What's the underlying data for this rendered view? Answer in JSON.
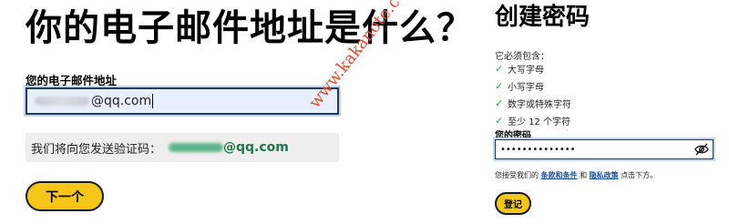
{
  "email_step": {
    "title": "你的电子邮件地址是什么？",
    "field_label": "您的电子邮件地址",
    "email_suffix": "@qq.com",
    "notice_text": "我们将向您发送验证码：",
    "notice_email_suffix": "@qq.com",
    "next_button": "下一个"
  },
  "watermark": "www.kakanote.com",
  "password_step": {
    "title": "创建密码",
    "requirements_intro": "它必须包含：",
    "requirements": [
      "大写字母",
      "小写字母",
      "数字或特殊字符",
      "至少 12 个字符"
    ],
    "password_label": "您的密码",
    "password_value": "••••••••••••••",
    "terms_prefix": "您接受我们的",
    "terms_link": "条款和条件",
    "terms_and": "和",
    "privacy_link": "隐私政策",
    "terms_suffix": "点击下方。",
    "login_button": "登记"
  },
  "colors": {
    "accent_button": "#f5c518",
    "check": "#2e9d4f",
    "link": "#1f4e9e",
    "watermark": "#e34a2f"
  },
  "icons": {
    "check": "check-icon",
    "eye": "eye-slash-icon"
  }
}
